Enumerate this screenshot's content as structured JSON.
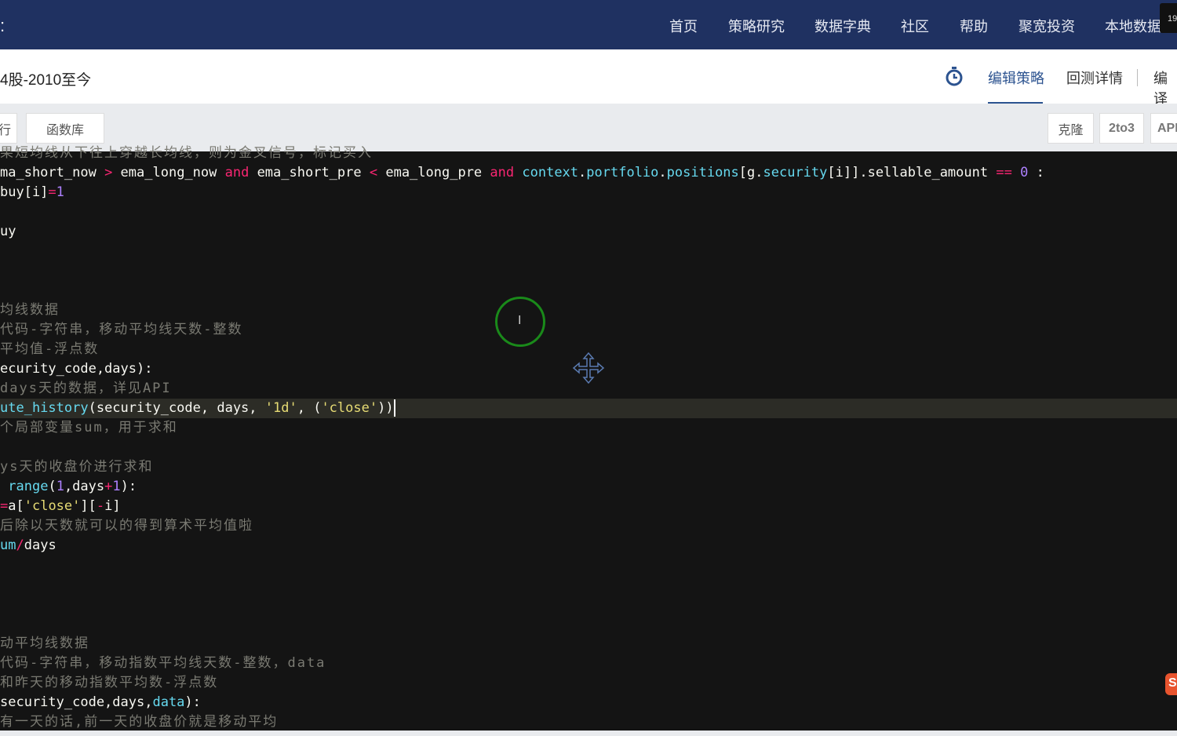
{
  "nav": {
    "items": [
      "首页",
      "策略研究",
      "数据字典",
      "社区",
      "帮助",
      "聚宽投资",
      "本地数据"
    ],
    "badge": "19",
    "menu_glyph": ":"
  },
  "header": {
    "title": "4股-2010至今",
    "tabs": [
      "编辑策略",
      "回测详情",
      "编译"
    ]
  },
  "toolbar": {
    "left": [
      "行",
      "函数库"
    ],
    "right": [
      "克隆",
      "2to3",
      "API"
    ]
  },
  "colors": {
    "nav": "#1f3161",
    "accent": "#2c5390",
    "keyword": "#f92672",
    "builtin": "#66d9ef",
    "number": "#ae81ff",
    "string": "#e6db74",
    "comment": "#7a7a72",
    "text": "#f8f8f2"
  },
  "editor": {
    "highlight_line": 13,
    "cursor_line": 13,
    "lines": [
      [
        [
          "c",
          "果短均线从下往上穿越长均线，则为金叉信号，标记买入"
        ]
      ],
      [
        [
          "t",
          "ma_short_now "
        ],
        [
          "k",
          ">"
        ],
        [
          "t",
          " ema_long_now "
        ],
        [
          "k",
          "and"
        ],
        [
          "t",
          " ema_short_pre "
        ],
        [
          "k",
          "<"
        ],
        [
          "t",
          " ema_long_pre "
        ],
        [
          "k",
          "and"
        ],
        [
          "t",
          " "
        ],
        [
          "b",
          "context"
        ],
        [
          "t",
          "."
        ],
        [
          "b",
          "portfolio"
        ],
        [
          "t",
          "."
        ],
        [
          "b",
          "positions"
        ],
        [
          "t",
          "[g."
        ],
        [
          "b",
          "security"
        ],
        [
          "t",
          "[i]]."
        ],
        [
          "t",
          "sellable_amount "
        ],
        [
          "k",
          "=="
        ],
        [
          "t",
          " "
        ],
        [
          "n",
          "0"
        ],
        [
          "t",
          " :"
        ]
      ],
      [
        [
          "t",
          "buy[i]"
        ],
        [
          "k",
          "="
        ],
        [
          "n",
          "1"
        ]
      ],
      [],
      [
        [
          "t",
          "uy"
        ]
      ],
      [],
      [],
      [],
      [
        [
          "c",
          "均线数据"
        ]
      ],
      [
        [
          "c",
          "代码-字符串，移动平均线天数-整数"
        ]
      ],
      [
        [
          "c",
          "平均值-浮点数"
        ]
      ],
      [
        [
          "t",
          "ecurity_code,days):"
        ]
      ],
      [
        [
          "c",
          "days天的数据，详见API"
        ]
      ],
      [
        [
          "b",
          "ute_history"
        ],
        [
          "t",
          "(security_code, days, "
        ],
        [
          "s",
          "'1d'"
        ],
        [
          "t",
          ", ("
        ],
        [
          "s",
          "'close'"
        ],
        [
          "t",
          "))"
        ]
      ],
      [
        [
          "c",
          "个局部变量sum，用于求和"
        ]
      ],
      [],
      [
        [
          "c",
          "ys天的收盘价进行求和"
        ]
      ],
      [
        [
          "t",
          " "
        ],
        [
          "b",
          "range"
        ],
        [
          "t",
          "("
        ],
        [
          "n",
          "1"
        ],
        [
          "t",
          ",days"
        ],
        [
          "k",
          "+"
        ],
        [
          "n",
          "1"
        ],
        [
          "t",
          "):"
        ]
      ],
      [
        [
          "k",
          "="
        ],
        [
          "t",
          "a["
        ],
        [
          "s",
          "'close'"
        ],
        [
          "t",
          "]["
        ],
        [
          "k",
          "-"
        ],
        [
          "t",
          "i]"
        ]
      ],
      [
        [
          "c",
          "后除以天数就可以的得到算术平均值啦"
        ]
      ],
      [
        [
          "b",
          "um"
        ],
        [
          "k",
          "/"
        ],
        [
          "t",
          "days"
        ]
      ],
      [],
      [],
      [],
      [],
      [
        [
          "c",
          "动平均线数据"
        ]
      ],
      [
        [
          "c",
          "代码-字符串，移动指数平均线天数-整数，data"
        ]
      ],
      [
        [
          "c",
          "和昨天的移动指数平均数-浮点数"
        ]
      ],
      [
        [
          "t",
          "security_code,days,"
        ],
        [
          "b",
          "data"
        ],
        [
          "t",
          "):"
        ]
      ],
      [
        [
          "c",
          "有一天的话,前一天的收盘价就是移动平均"
        ]
      ]
    ]
  }
}
